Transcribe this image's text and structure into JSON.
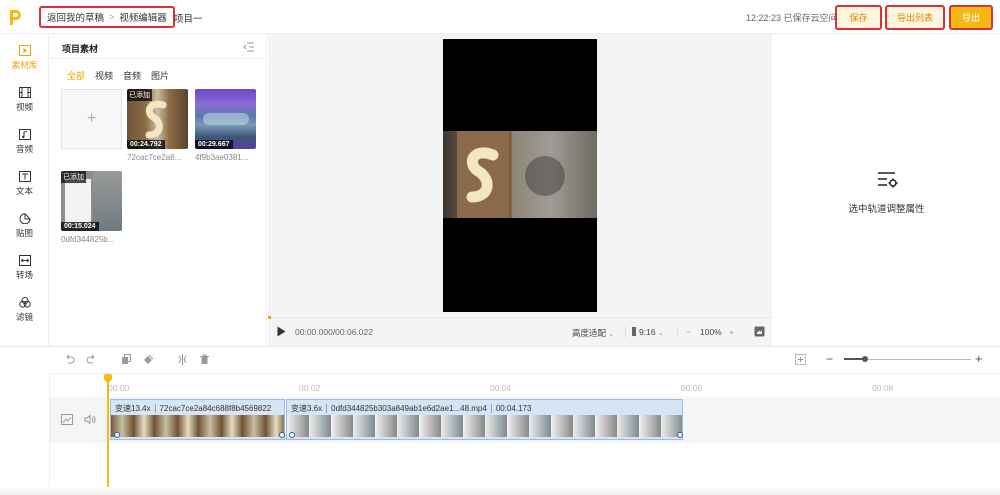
{
  "header": {
    "breadcrumb_back": "返回我的草稿",
    "breadcrumb_sep": ">",
    "breadcrumb_current": "视频编辑器",
    "project_name": "项目一",
    "save_status": "12:22:23 已保存云空间",
    "save_label": "保存",
    "export_list_label": "导出列表",
    "export_label": "导出"
  },
  "nav": {
    "items": [
      {
        "label": "素材库",
        "icon": "media-library-icon",
        "active": true
      },
      {
        "label": "视频",
        "icon": "film-icon"
      },
      {
        "label": "音频",
        "icon": "music-icon"
      },
      {
        "label": "文本",
        "icon": "text-icon"
      },
      {
        "label": "贴图",
        "icon": "sticker-icon"
      },
      {
        "label": "转场",
        "icon": "transition-icon"
      },
      {
        "label": "滤镜",
        "icon": "filter-icon"
      }
    ]
  },
  "assets": {
    "title": "项目素材",
    "tabs": [
      "全部",
      "视频",
      "音频",
      "图片"
    ],
    "upload_symbol": "+",
    "items": [
      {
        "tag": "已添加",
        "duration": "00:24.792",
        "name": "72cac7ce2a8..."
      },
      {
        "tag": "",
        "duration": "00:29.667",
        "name": "4f9b3ae0381..."
      },
      {
        "tag": "已添加",
        "duration": "00:15.024",
        "name": "0dfd344825b..."
      }
    ]
  },
  "preview": {
    "time": "00:00.000/00:06.022",
    "fit_mode": "高度适配",
    "ratio": "9:16",
    "zoom_minus": "−",
    "zoom_value": "100%",
    "zoom_plus": "+"
  },
  "properties": {
    "hint": "选中轨道调整属性"
  },
  "timeline": {
    "ruler": [
      "00:00",
      "00:02",
      "00:04",
      "00:06",
      "00:08"
    ],
    "zoom_minus": "−",
    "zoom_plus": "+",
    "clips": [
      {
        "speed": "变速13.4x",
        "name": "72cac7ce2a84c688f8b4569822"
      },
      {
        "speed": "变速3.6x",
        "name": "0dfd344825b303a849ab1e6d2ae1...48.mp4",
        "duration": "00:04.173"
      }
    ]
  },
  "colors": {
    "accent": "#f5b915",
    "accent_text": "#f0a400",
    "annotation_red": "#d9303a",
    "clip_fill": "#d5e5f5"
  }
}
